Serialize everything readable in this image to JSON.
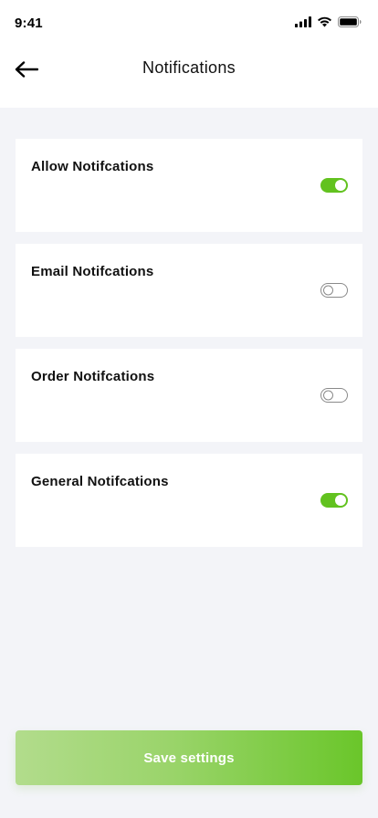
{
  "status_bar": {
    "time": "9:41",
    "icons": [
      "signal-icon",
      "wifi-icon",
      "battery-icon"
    ]
  },
  "header": {
    "back_icon": "arrow-left-icon",
    "title": "Notifications"
  },
  "settings": [
    {
      "label": "Allow Notifcations",
      "enabled": true
    },
    {
      "label": "Email Notifcations",
      "enabled": false
    },
    {
      "label": "Order Notifcations",
      "enabled": false
    },
    {
      "label": "General Notifcations",
      "enabled": true
    }
  ],
  "footer": {
    "save_label": "Save settings"
  },
  "colors": {
    "accent": "#62c21f",
    "background": "#f3f4f8",
    "toggle_off_border": "#8a8a8a",
    "button_gradient_start": "#b2dc8c",
    "button_gradient_end": "#6ac62a"
  }
}
